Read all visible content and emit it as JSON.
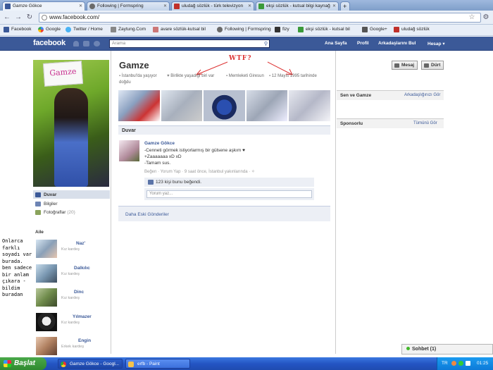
{
  "browser": {
    "tabs": [
      {
        "label": "Gamze Gökce",
        "color": "#3b5998"
      },
      {
        "label": "Following | Formspring",
        "color": "#6a6a6a"
      },
      {
        "label": "uludağ sözlük - türk televizyon",
        "color": "#c0302a"
      },
      {
        "label": "ekşi sözlük - kutsal bilgi kaynağ",
        "color": "#3a9a3a"
      }
    ],
    "url": "www.facebook.com/",
    "bookmarks": [
      "Facebook",
      "Google",
      "Twitter / Home",
      "Zaytung.Com",
      "avare sözlük-kutsal bil",
      "Following | Formspring",
      "fizy",
      "ekşi sözlük - kutsal bil",
      "Google+",
      "uludağ sözlük"
    ]
  },
  "fb": {
    "logo": "facebook",
    "search_placeholder": "Arama",
    "nav": [
      "Ana Sayfa",
      "Profil",
      "Arkadaşlarını Bul",
      "Hesap ▾"
    ]
  },
  "profile": {
    "name": "Gamze",
    "sign_text": "Gamze",
    "annotation": "WTF?",
    "info": [
      "İstanbul'da yaşıyor",
      "Birlikte yaşadığı biri var",
      "Memleketi Giresun",
      "12 Mayıs 1995 tarihinde",
      "doğdu"
    ],
    "buttons": {
      "message": "Mesaj",
      "poke": "Dürt"
    }
  },
  "left_nav": [
    {
      "label": "Duvar"
    },
    {
      "label": "Bilgiler"
    },
    {
      "label": "Fotoğraflar",
      "count": "(20)"
    }
  ],
  "family": {
    "title": "Aile",
    "members": [
      {
        "name": "Naz'",
        "relation": "Kız kardeş"
      },
      {
        "name": "Dalkılıc",
        "relation": "Kız kardeş"
      },
      {
        "name": "Dinc",
        "relation": "Kız kardeş"
      },
      {
        "name": "Yılmazer",
        "relation": "Kız kardeş"
      },
      {
        "name": "Engin",
        "relation": "Erkek kardeş"
      }
    ]
  },
  "overlay_text": "Onlarca farklı soyadı var burada. ben sadece bir anlam çıkara -bildim buradan",
  "wall": {
    "header": "Duvar",
    "post": {
      "author": "Gamze Gökce",
      "lines": [
        "-Cenneti görmek istiyorlarmış bir gülsene aşkım ♥",
        "+Zaaaaaaa xD xD",
        "-Tamam sus."
      ],
      "meta": "Beğen · Yorum Yap · 9 saat önce, İstanbul yakınlarında ·",
      "likes": "123 kişi bunu beğendi.",
      "comment_placeholder": "Yorum yaz..."
    },
    "older": "Daha Eski Gönderiler"
  },
  "sidebar": {
    "you_and": "Sen ve Gamze",
    "friendship_link": "Arkadaşlığınızı Gör",
    "sponsored": "Sponsorlu",
    "see_all": "Tümünü Gör"
  },
  "chat": {
    "label": "Sohbet (1)"
  },
  "taskbar": {
    "start": "Başlat",
    "items": [
      "Gamze Gökce - Googl...",
      "erfb - Paint"
    ],
    "lang": "TR",
    "time": "01:25"
  }
}
